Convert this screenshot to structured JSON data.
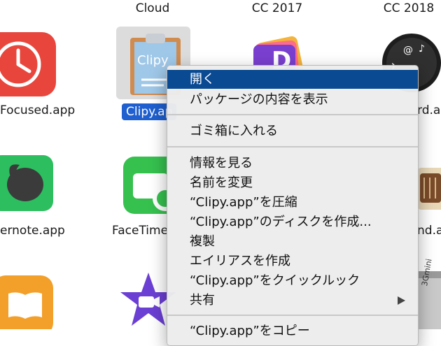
{
  "columns": {
    "col1": "Cloud",
    "col2": "CC 2017",
    "col3": "CC 2018"
  },
  "apps": {
    "focused": "Focused.app",
    "clipy_partial": "Clipy.ap",
    "clipy_logo": "Clipy",
    "dashboard_partial": "rd.ap",
    "evernote_partial": "ernote.app",
    "facetime_partial": "FaceTime",
    "right_partial": "nd.ap",
    "bottom_right_partial": "3Gmini"
  },
  "context_menu": {
    "items": [
      {
        "label": "開く"
      },
      {
        "label": "パッケージの内容を表示"
      },
      {
        "label": "ゴミ箱に入れる"
      },
      {
        "label": "情報を見る"
      },
      {
        "label": "名前を変更"
      },
      {
        "label": "“Clipy.app”を圧縮"
      },
      {
        "label": "“Clipy.app”のディスクを作成..."
      },
      {
        "label": "複製"
      },
      {
        "label": "エイリアスを作成"
      },
      {
        "label": "“Clipy.app”をクイックルック"
      },
      {
        "label": "共有"
      },
      {
        "label": "“Clipy.app”をコピー"
      }
    ]
  },
  "colors": {
    "highlight": "#0a4a93",
    "selection": "#1f5fcf",
    "focused_red": "#e8463c",
    "evernote_green": "#2dbe60",
    "facetime_green": "#36c14f",
    "ibooks_orange": "#f3a02a",
    "imovie_purple": "#6b3fd3"
  }
}
